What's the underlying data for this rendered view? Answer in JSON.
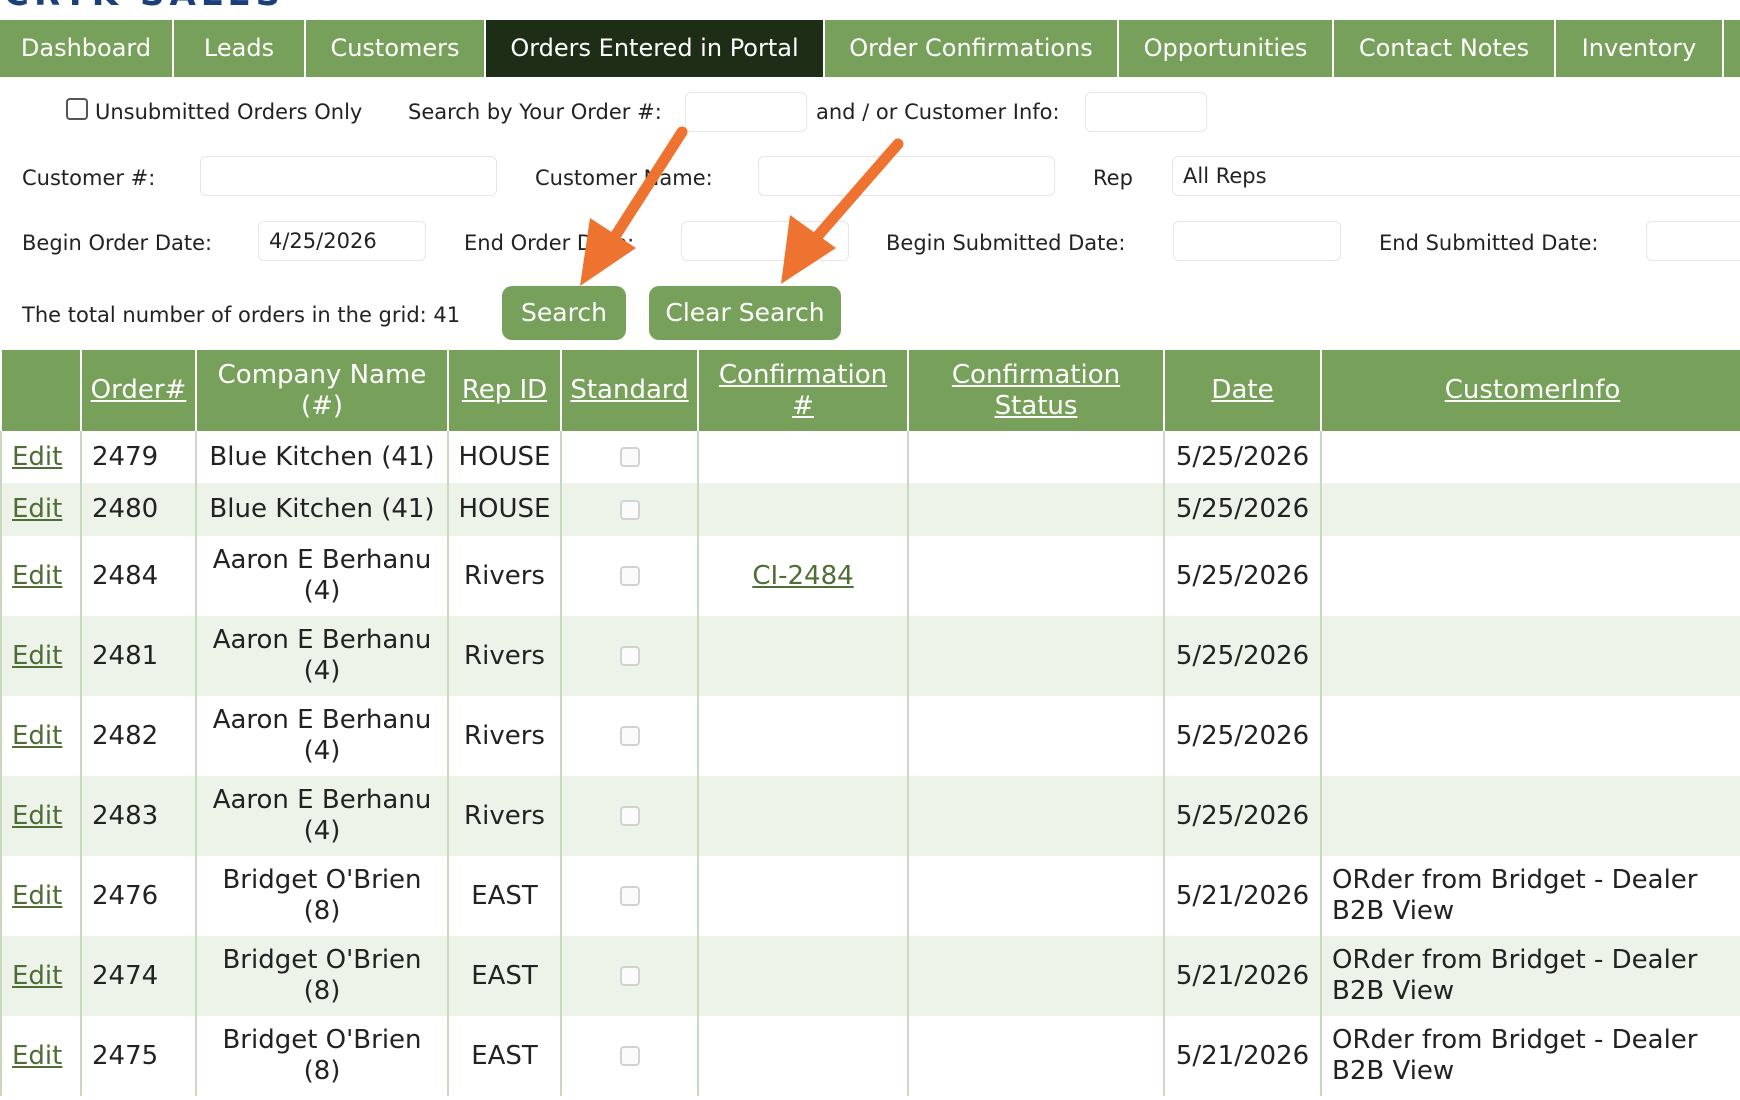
{
  "logo": {
    "text": "CRTK SALES"
  },
  "nav": {
    "items": [
      {
        "label": "Dashboard",
        "active": false
      },
      {
        "label": "Leads",
        "active": false
      },
      {
        "label": "Customers",
        "active": false
      },
      {
        "label": "Orders Entered in Portal",
        "active": true
      },
      {
        "label": "Order Confirmations",
        "active": false
      },
      {
        "label": "Opportunities",
        "active": false
      },
      {
        "label": "Contact Notes",
        "active": false
      },
      {
        "label": "Inventory",
        "active": false
      }
    ]
  },
  "filters": {
    "unsubmitted_label": "Unsubmitted Orders Only",
    "search_order_label": "Search by Your Order #:",
    "customer_info_label": "and / or Customer Info:",
    "customer_num_label": "Customer #:",
    "customer_name_label": "Customer Name:",
    "rep_label": "Rep",
    "rep_value": "All Reps",
    "begin_order_date_label": "Begin Order Date:",
    "begin_order_date_value": "4/25/2026",
    "end_order_date_label": "End Order Date:",
    "begin_submitted_label": "Begin Submitted Date:",
    "end_submitted_label": "End Submitted Date:",
    "total_orders_text": "The total number of orders in the grid: 41",
    "search_button": "Search",
    "clear_button": "Clear Search"
  },
  "table": {
    "headers": {
      "order": "Order#",
      "company_line1": "Company Name",
      "company_line2": "(#)",
      "rep": "Rep ID",
      "standard": "Standard",
      "conf_num_line1": "Confirmation",
      "conf_num_line2": "#",
      "conf_status_line1": "Confirmation",
      "conf_status_line2": "Status",
      "date": "Date",
      "customer_info": "CustomerInfo"
    },
    "edit_label": "Edit",
    "rows": [
      {
        "order": "2479",
        "company": "Blue Kitchen (41)",
        "rep": "HOUSE",
        "confirmation": "",
        "status": "",
        "date": "5/25/2026",
        "info": ""
      },
      {
        "order": "2480",
        "company": "Blue Kitchen (41)",
        "rep": "HOUSE",
        "confirmation": "",
        "status": "",
        "date": "5/25/2026",
        "info": ""
      },
      {
        "order": "2484",
        "company": "Aaron E Berhanu (4)",
        "rep": "Rivers",
        "confirmation": "CI-2484",
        "status": "",
        "date": "5/25/2026",
        "info": ""
      },
      {
        "order": "2481",
        "company": "Aaron E Berhanu (4)",
        "rep": "Rivers",
        "confirmation": "",
        "status": "",
        "date": "5/25/2026",
        "info": ""
      },
      {
        "order": "2482",
        "company": "Aaron E Berhanu (4)",
        "rep": "Rivers",
        "confirmation": "",
        "status": "",
        "date": "5/25/2026",
        "info": ""
      },
      {
        "order": "2483",
        "company": "Aaron E Berhanu (4)",
        "rep": "Rivers",
        "confirmation": "",
        "status": "",
        "date": "5/25/2026",
        "info": ""
      },
      {
        "order": "2476",
        "company": "Bridget O'Brien (8)",
        "rep": "EAST",
        "confirmation": "",
        "status": "",
        "date": "5/21/2026",
        "info": "ORder from Bridget - Dealer B2B View"
      },
      {
        "order": "2474",
        "company": "Bridget O'Brien (8)",
        "rep": "EAST",
        "confirmation": "",
        "status": "",
        "date": "5/21/2026",
        "info": "ORder from Bridget - Dealer B2B View"
      },
      {
        "order": "2475",
        "company": "Bridget O'Brien (8)",
        "rep": "EAST",
        "confirmation": "",
        "status": "",
        "date": "5/21/2026",
        "info": "ORder from Bridget - Dealer B2B View"
      }
    ]
  },
  "annotations": {
    "arrow_color": "#ee7330"
  }
}
